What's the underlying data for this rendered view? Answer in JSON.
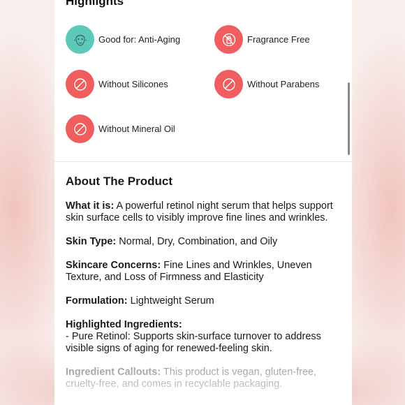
{
  "highlights": {
    "title": "Highlights",
    "items": [
      {
        "label": "Good for: Anti-Aging",
        "icon": "face-icon",
        "color": "#5ec9b8"
      },
      {
        "label": "Fragrance Free",
        "icon": "no-fragrance-icon",
        "color": "#ef5d5e"
      },
      {
        "label": "Without Silicones",
        "icon": "prohibited-icon",
        "color": "#ef5d5e"
      },
      {
        "label": "Without Parabens",
        "icon": "prohibited-icon",
        "color": "#ef5d5e"
      },
      {
        "label": "Without Mineral Oil",
        "icon": "prohibited-icon",
        "color": "#ef5d5e"
      }
    ]
  },
  "about": {
    "title": "About The Product",
    "what_label": "What it is:",
    "what_text": " A powerful retinol night serum that helps support skin surface cells to visibly improve fine lines and wrinkles.",
    "skin_type_label": "Skin Type:",
    "skin_type_text": " Normal, Dry, Combination, and Oily",
    "concerns_label": "Skincare Concerns:",
    "concerns_text": " Fine Lines and Wrinkles, Uneven Texture, and Loss of Firmness and Elasticity",
    "formulation_label": "Formulation:",
    "formulation_text": " Lightweight Serum",
    "ingredients_label": "Highlighted Ingredients:",
    "ingredients_text": "- Pure Retinol: Supports skin-surface turnover to address visible signs of aging for renewed-feeling skin.",
    "callouts_label": "Ingredient Callouts:",
    "callouts_text": " This product is vegan, gluten-free, cruelty-free, and comes in recyclable packaging."
  }
}
